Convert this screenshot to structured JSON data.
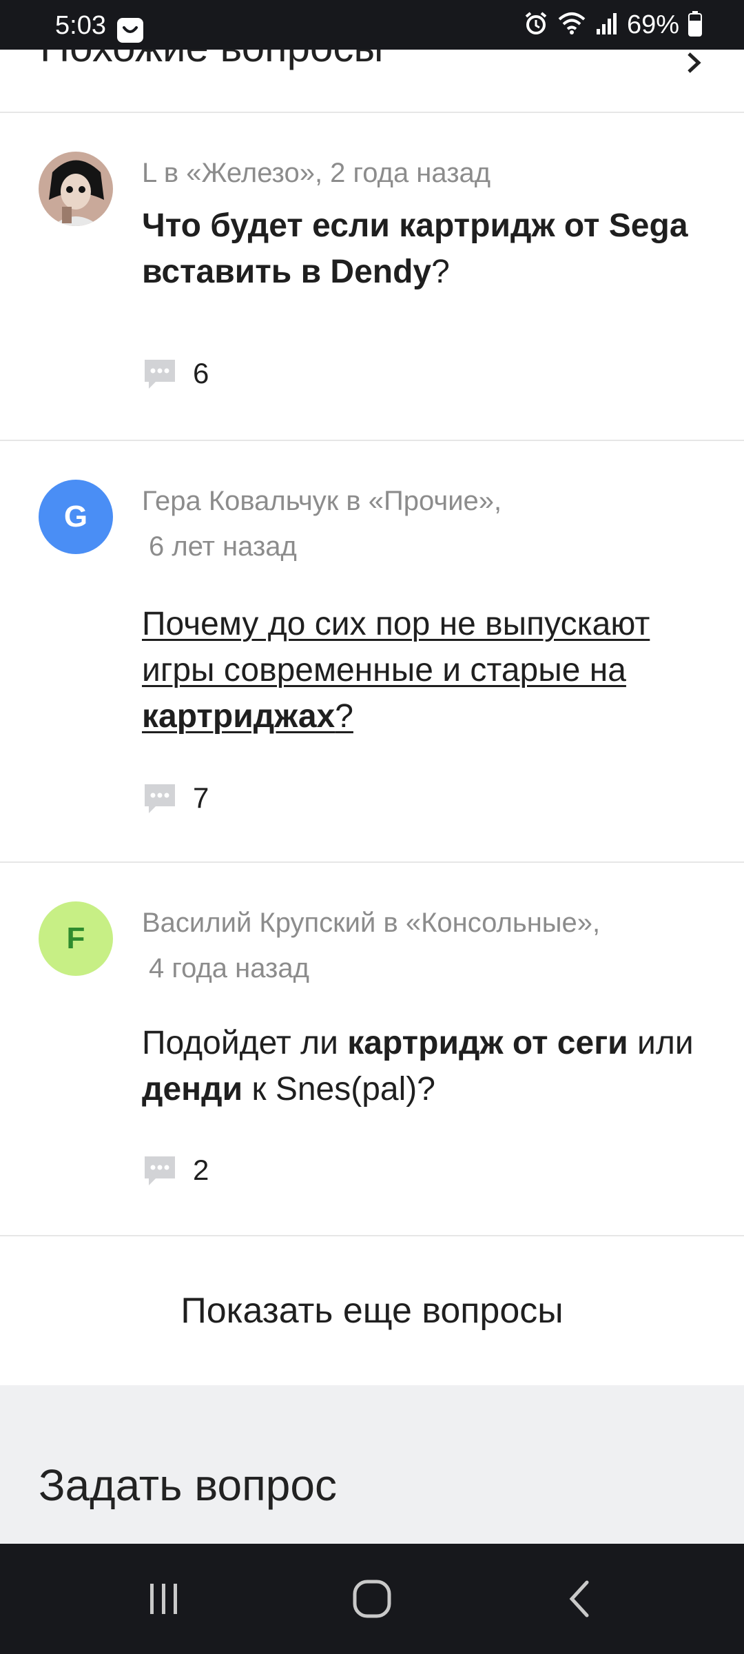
{
  "status_bar": {
    "time": "5:03",
    "battery": "69%"
  },
  "section": {
    "title": "Похожие вопросы"
  },
  "questions": [
    {
      "author": "L",
      "meta_line1": "L в «Железо», 2 года назад",
      "title_parts": [
        "Что будет если картридж от Sega вставить в Dendy",
        "?"
      ],
      "comments": "6",
      "avatar": "anime-character-avatar"
    },
    {
      "author": "Гера Ковальчук",
      "avatar_letter": "G",
      "avatar_color": "#4a8ef5",
      "meta_line1": "Гера Ковальчук в «Прочие»,",
      "meta_line2": "6 лет назад",
      "title_parts": [
        "Почему до сих пор не выпускают игры современные и старые на ",
        "картриджах",
        "?"
      ],
      "comments": "7"
    },
    {
      "author": "Василий Крупский",
      "avatar_letter": "F",
      "avatar_color": "#c7ef85",
      "meta_line1": "Василий Крупский в «Консольные»,",
      "meta_line2": "4 года назад",
      "title_parts": [
        "Подойдет ли ",
        "картридж от сеги",
        " или ",
        "денди",
        " к Snes(pal)?"
      ],
      "comments": "2"
    }
  ],
  "show_more_label": "Показать еще вопросы",
  "ask_question_label": "Задать вопрос",
  "icons": {
    "comment": "comment-bubble-icon",
    "alarm": "alarm-icon",
    "wifi": "wifi-icon",
    "signal": "signal-icon",
    "battery": "battery-icon"
  },
  "colors": {
    "status_bar_bg": "#17181c",
    "meta_text": "#8c8c8c",
    "divider": "#e6e6e6",
    "ask_bg": "#eff0f2"
  }
}
